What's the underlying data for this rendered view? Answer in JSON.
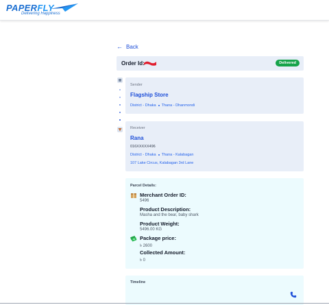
{
  "brand": {
    "name_part1": "PAPER",
    "name_part2": "FLY",
    "tagline": "Delivering Happiness"
  },
  "nav": {
    "back_label": "Back"
  },
  "order": {
    "label": "Order Id:",
    "status": "Delivered"
  },
  "sender": {
    "caption": "Sender",
    "name": "Flagship Store",
    "district": "District - Dhaka",
    "thana": "Thana - Dhanmondi"
  },
  "receiver": {
    "caption": "Receiver",
    "name": "Rana",
    "phone": "016XXXXX496",
    "district": "District - Dhaka",
    "thana": "Thana - Kalabagan",
    "address": "107 Lake Circus, Kalabagan 3rd Lane"
  },
  "parcel": {
    "title": "Parcel Details:",
    "merchant_order_id_label": "Merchant Order ID:",
    "merchant_order_id": "5496",
    "description_label": "Product Description:",
    "description": "Masha and the bear, baby shark",
    "weight_label": "Product Weight:",
    "weight": "5496.00 KG",
    "price_label": "Package price:",
    "price": "৳ 2600",
    "collected_label": "Collected Amount:",
    "collected": "৳ 0"
  },
  "timeline": {
    "title": "Timeline"
  },
  "colors": {
    "brand_blue": "#1c6fd1",
    "link_blue": "#1d4ed8",
    "status_green": "#16a34a",
    "card_bg": "#e8eef8",
    "parcel_bg": "#ecfbfe"
  },
  "icons": {
    "back": "arrow-left-icon",
    "merchant": "package-icon",
    "price": "money-icon",
    "timeline_action": "phone-icon"
  }
}
